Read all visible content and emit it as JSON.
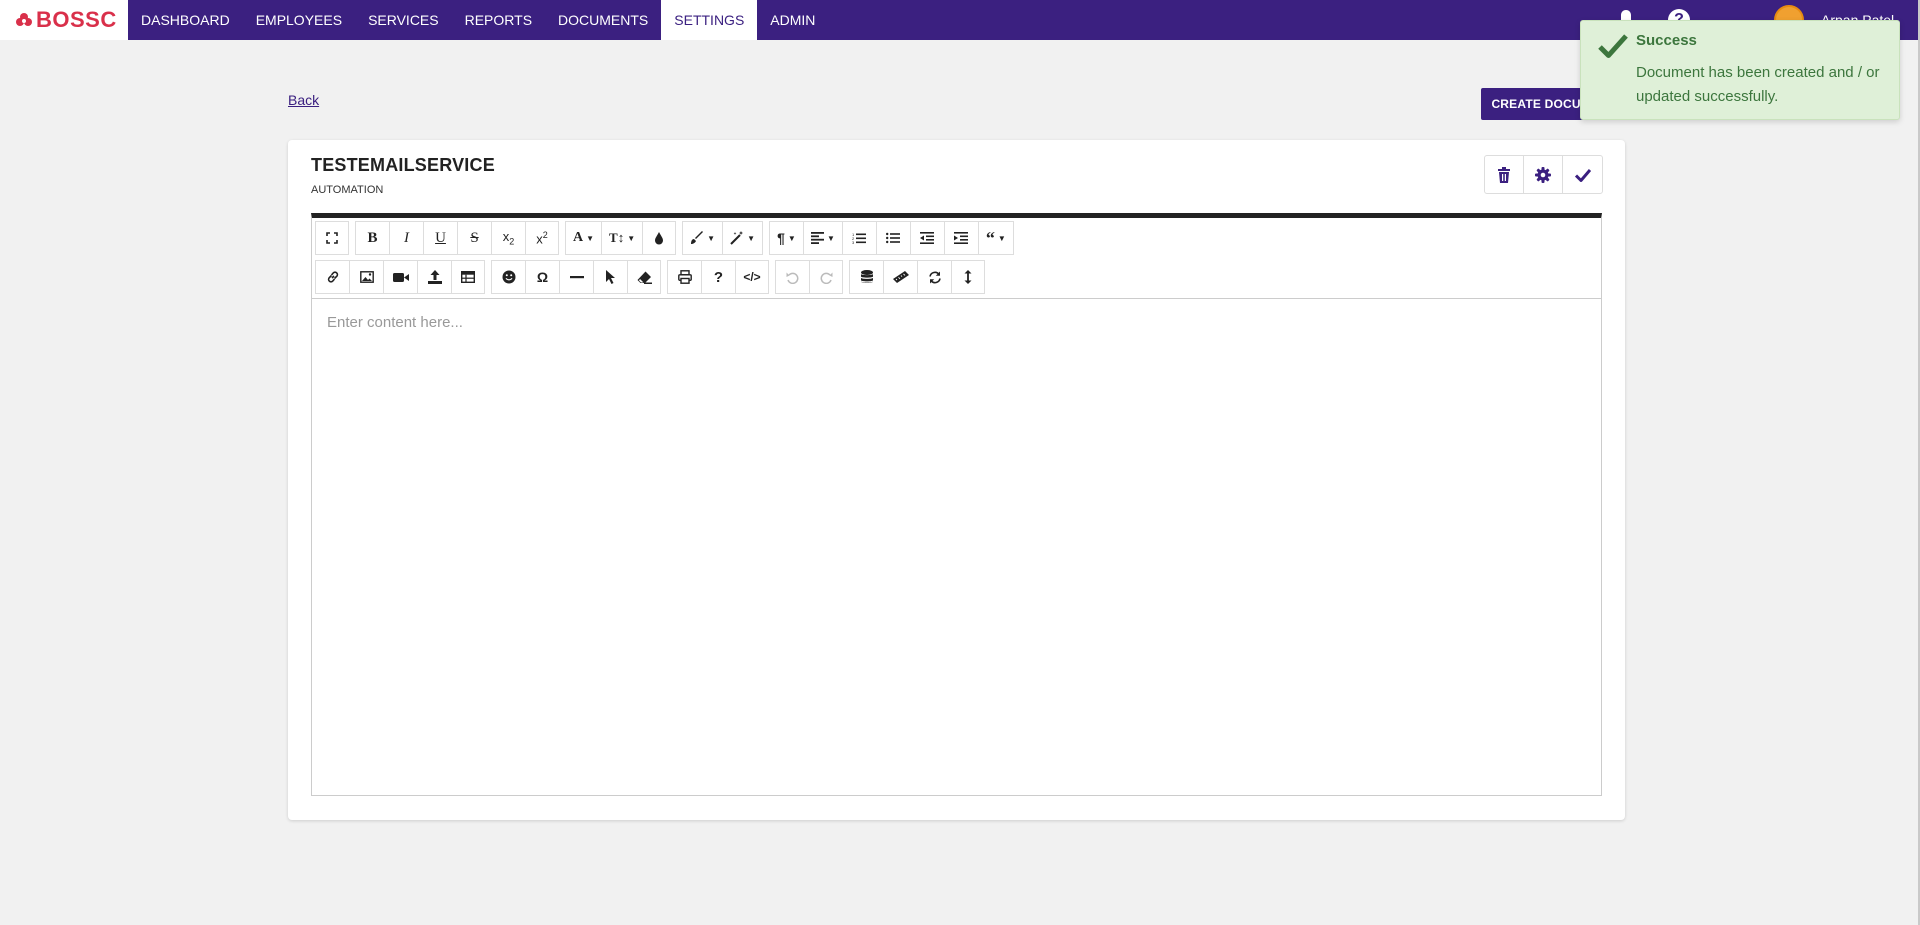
{
  "brand": {
    "name": "BOSSC",
    "color": "#d9304a",
    "nav_color": "#3b2080"
  },
  "nav": {
    "items": [
      {
        "label": "DASHBOARD"
      },
      {
        "label": "EMPLOYEES"
      },
      {
        "label": "SERVICES"
      },
      {
        "label": "REPORTS"
      },
      {
        "label": "DOCUMENTS"
      },
      {
        "label": "SETTINGS",
        "active": true
      },
      {
        "label": "ADMIN"
      }
    ]
  },
  "header_right": {
    "icons": [
      "bell-icon",
      "help-icon"
    ],
    "user_name": "Arpan Patel"
  },
  "page": {
    "back_label": "Back",
    "create_label": "CREATE DOCUMENT"
  },
  "document": {
    "title": "TESTEMAILSERVICE",
    "category": "AUTOMATION",
    "actions": [
      "trash-icon",
      "gear-icon",
      "check-icon"
    ]
  },
  "editor": {
    "placeholder": "Enter content here...",
    "toolbar_row1": [
      "fullscreen",
      "bold",
      "italic",
      "underline",
      "strikethrough",
      "subscript",
      "superscript",
      "font-family",
      "font-size",
      "color",
      "paragraph-style",
      "inline-style",
      "paragraph-format",
      "align",
      "ordered-list",
      "unordered-list",
      "outdent",
      "indent",
      "quote"
    ],
    "toolbar_row2": [
      "link",
      "image",
      "video",
      "file-upload",
      "table",
      "emoticons",
      "special-characters",
      "horizontal-line",
      "select-all",
      "clear-formatting",
      "print",
      "help",
      "code-view",
      "undo",
      "redo",
      "database",
      "ruler",
      "replace",
      "line-height"
    ]
  },
  "toast": {
    "title": "Success",
    "message": "Document has been created and / or updated successfully.",
    "color": "#3c763d",
    "background": "#dff0d8"
  }
}
